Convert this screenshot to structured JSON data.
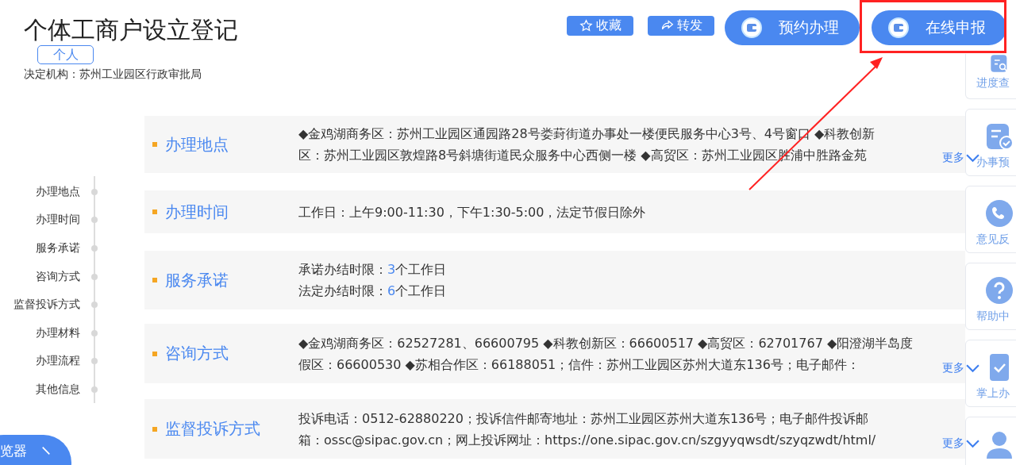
{
  "title": "个体工商户设立登记",
  "tag": "个人",
  "authority": "决定机构：苏州工业园区行政审批局",
  "actions": [
    {
      "label": "收藏",
      "kind": "star"
    },
    {
      "label": "转发",
      "kind": "share"
    }
  ],
  "main_buttons": [
    {
      "label": "预约办理"
    },
    {
      "label": "在线申报"
    }
  ],
  "nav": [
    {
      "label": "办理地点"
    },
    {
      "label": "办理时间"
    },
    {
      "label": "服务承诺"
    },
    {
      "label": "咨询方式"
    },
    {
      "label": "监督投诉方式"
    },
    {
      "label": "办理材料"
    },
    {
      "label": "办理流程"
    },
    {
      "label": "其他信息"
    }
  ],
  "sections": [
    {
      "title": "办理地点",
      "kind": "text",
      "lines": [
        "◆金鸡湖商务区：苏州工业园区通园路28号娄葑街道办事处一楼便民服务中心3号、4号窗口 ◆科教创新",
        "区：苏州工业园区敦煌路8号斜塘街道民众服务中心西侧一楼 ◆高贸区：苏州工业园区胜浦中胜路金苑"
      ],
      "more": "更多"
    },
    {
      "title": "办理时间",
      "kind": "text",
      "lines": [
        "工作日：上午9:00-11:30，下午1:30-5:00，法定节假日除外"
      ]
    },
    {
      "title": "服务承诺",
      "kind": "limits",
      "limits": [
        {
          "label": "承诺办结时限：",
          "value": "3",
          "unit": "个工作日"
        },
        {
          "label": "法定办结时限：",
          "value": "6",
          "unit": "个工作日"
        }
      ]
    },
    {
      "title": "咨询方式",
      "kind": "text",
      "lines": [
        "◆金鸡湖商务区：62527281、66600795 ◆科教创新区：66600517 ◆高贸区：62701767 ◆阳澄湖半岛度",
        "假区：66600530 ◆苏相合作区：66188051；信件：苏州工业园区苏州大道东136号；电子邮件："
      ],
      "more": "更多"
    },
    {
      "title": "监督投诉方式",
      "kind": "text",
      "lines": [
        "投诉电话：0512-62880220；投诉信件邮寄地址：苏州工业园区苏州大道东136号；电子邮件投诉邮",
        "箱：ossc@sipac.gov.cn；网上投诉网址：https://one.sipac.gov.cn/szgyyqwsdt/szyqzwdt/html/"
      ],
      "more": "更多"
    }
  ],
  "dock": [
    {
      "label": "进度查",
      "kind": "search-doc"
    },
    {
      "label": "办事预",
      "kind": "check-doc"
    },
    {
      "label": "意见反",
      "kind": "phone"
    },
    {
      "label": "帮助中",
      "kind": "help"
    },
    {
      "label": "掌上办",
      "kind": "mobile"
    },
    {
      "kind": "person"
    }
  ],
  "browser_button": "览器"
}
